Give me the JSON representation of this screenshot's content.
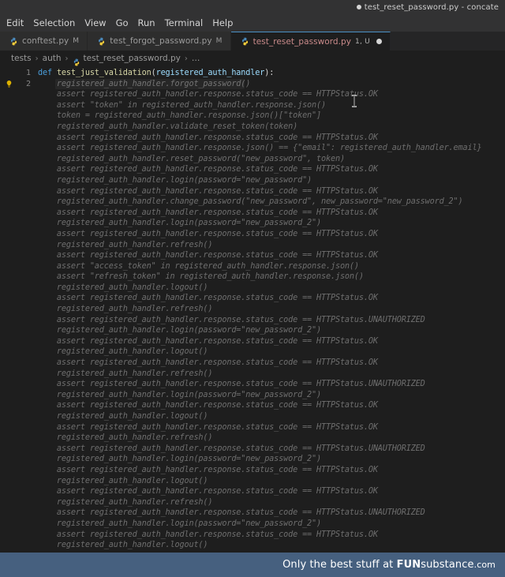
{
  "window": {
    "title": "test_reset_password.py - concate",
    "dirty_indicator": "●"
  },
  "menubar": {
    "items": [
      "Edit",
      "Selection",
      "View",
      "Go",
      "Run",
      "Terminal",
      "Help"
    ]
  },
  "tabs": [
    {
      "label": "conftest.py",
      "badge": "M",
      "icon": "python-file-icon",
      "active": false,
      "dirty": false
    },
    {
      "label": "test_forgot_password.py",
      "badge": "M",
      "icon": "python-file-icon",
      "active": false,
      "dirty": false
    },
    {
      "label": "test_reset_password.py",
      "badge": "1, U",
      "icon": "python-file-icon",
      "active": true,
      "dirty": true
    }
  ],
  "breadcrumb": {
    "separator": "›",
    "items": [
      {
        "label": "tests",
        "icon": null
      },
      {
        "label": "auth",
        "icon": null
      },
      {
        "label": "test_reset_password.py",
        "icon": "python-file-icon"
      },
      {
        "label": "…",
        "icon": null
      }
    ]
  },
  "gutter": {
    "line_numbers": [
      "1",
      "2"
    ],
    "lightbulb_line": 2,
    "lightbulb_icon": "lightbulb-icon",
    "lightbulb_color": "#ddb100"
  },
  "editor": {
    "real_code": {
      "indent": "",
      "keyword": "def",
      "function_name": "test_just_validation",
      "open_paren": "(",
      "param": "registered_auth_handler",
      "close_paren": "):"
    },
    "ghost_lines": [
      "    registered_auth_handler.forgot_password()",
      "    assert registered_auth_handler.response.status_code == HTTPStatus.OK",
      "    assert \"token\" in registered_auth_handler.response.json()",
      "    token = registered_auth_handler.response.json()[\"token\"]",
      "    registered_auth_handler.validate_reset_token(token)",
      "    assert registered_auth_handler.response.status_code == HTTPStatus.OK",
      "    assert registered_auth_handler.response.json() == {\"email\": registered_auth_handler.email}",
      "    registered_auth_handler.reset_password(\"new_password\", token)",
      "    assert registered_auth_handler.response.status_code == HTTPStatus.OK",
      "    registered_auth_handler.login(password=\"new_password\")",
      "    assert registered_auth_handler.response.status_code == HTTPStatus.OK",
      "    registered_auth_handler.change_password(\"new_password\", new_password=\"new_password_2\")",
      "    assert registered_auth_handler.response.status_code == HTTPStatus.OK",
      "    registered_auth_handler.login(password=\"new_password_2\")",
      "    assert registered_auth_handler.response.status_code == HTTPStatus.OK",
      "    registered_auth_handler.refresh()",
      "    assert registered_auth_handler.response.status_code == HTTPStatus.OK",
      "    assert \"access_token\" in registered_auth_handler.response.json()",
      "    assert \"refresh_token\" in registered_auth_handler.response.json()",
      "    registered_auth_handler.logout()",
      "    assert registered_auth_handler.response.status_code == HTTPStatus.OK",
      "    registered_auth_handler.refresh()",
      "    assert registered_auth_handler.response.status_code == HTTPStatus.UNAUTHORIZED",
      "    registered_auth_handler.login(password=\"new_password_2\")",
      "    assert registered_auth_handler.response.status_code == HTTPStatus.OK",
      "    registered_auth_handler.logout()",
      "    assert registered_auth_handler.response.status_code == HTTPStatus.OK",
      "    registered_auth_handler.refresh()",
      "    assert registered_auth_handler.response.status_code == HTTPStatus.UNAUTHORIZED",
      "    registered_auth_handler.login(password=\"new_password_2\")",
      "    assert registered_auth_handler.response.status_code == HTTPStatus.OK",
      "    registered_auth_handler.logout()",
      "    assert registered_auth_handler.response.status_code == HTTPStatus.OK",
      "    registered_auth_handler.refresh()",
      "    assert registered_auth_handler.response.status_code == HTTPStatus.UNAUTHORIZED",
      "    registered_auth_handler.login(password=\"new_password_2\")",
      "    assert registered_auth_handler.response.status_code == HTTPStatus.OK",
      "    registered_auth_handler.logout()",
      "    assert registered_auth_handler.response.status_code == HTTPStatus.OK",
      "    registered_auth_handler.refresh()",
      "    assert registered_auth_handler.response.status_code == HTTPStatus.UNAUTHORIZED",
      "    registered_auth_handler.login(password=\"new_password_2\")",
      "    assert registered_auth_handler.response.status_code == HTTPStatus.OK",
      "    registered_auth_handler.logout()"
    ]
  },
  "watermark": {
    "prefix": "Only the best stuff at ",
    "brand_bold": "FUN",
    "brand_normal": "substance",
    "tld": ".com",
    "background": "#46607f"
  },
  "colors": {
    "titlebar_bg": "#323233",
    "tabbar_bg": "#252526",
    "editor_bg": "#1e1e1e",
    "active_tab_bg": "#1e1e1e",
    "active_tab_border": "#4a8fc4",
    "active_tab_text": "#c98a8a",
    "ghost_text": "#6e6e6e",
    "keyword": "#4a9edb",
    "function": "#d6d6a6",
    "param": "#9cdcfe"
  }
}
